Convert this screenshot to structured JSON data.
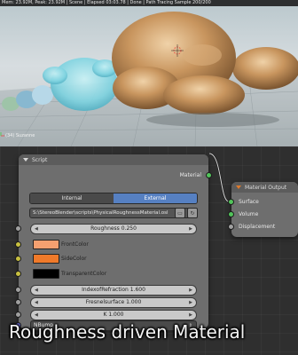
{
  "render": {
    "info_bar": "Mem: 23.92M, Peak: 23.92M | Scene | Elapsed 03:03.78 | Done | Path Tracing Sample 200/200",
    "view_label": "(34) Suzanne"
  },
  "script_node": {
    "title": "Script",
    "output_label": "Material",
    "tabs": {
      "internal": "Internal",
      "external": "External"
    },
    "file_path": "S:\\StereoBlender\\scripts\\PhysicalRoughnessMaterial.osl",
    "roughness": "Roughness 0.250",
    "colors": [
      {
        "label": "FrontColor",
        "hex": "#f5a070"
      },
      {
        "label": "SideColor",
        "hex": "#f07a2a"
      },
      {
        "label": "TransparentColor",
        "hex": "#000000"
      }
    ],
    "ior": "IndexofRefraction 1.600",
    "fresnel": "Fresnelsurface 1.000",
    "k": "K 1.000",
    "bump": "NBump"
  },
  "output_node": {
    "title": "Material Output",
    "inputs": [
      "Surface",
      "Volume",
      "Displacement"
    ]
  },
  "caption": "Roughness driven Material",
  "colors": {
    "socket_shader": "#52c45b",
    "socket_float": "#a0a0a0",
    "socket_color": "#c8c040",
    "socket_vector": "#6466c8",
    "tab_active": "#5680c2"
  }
}
